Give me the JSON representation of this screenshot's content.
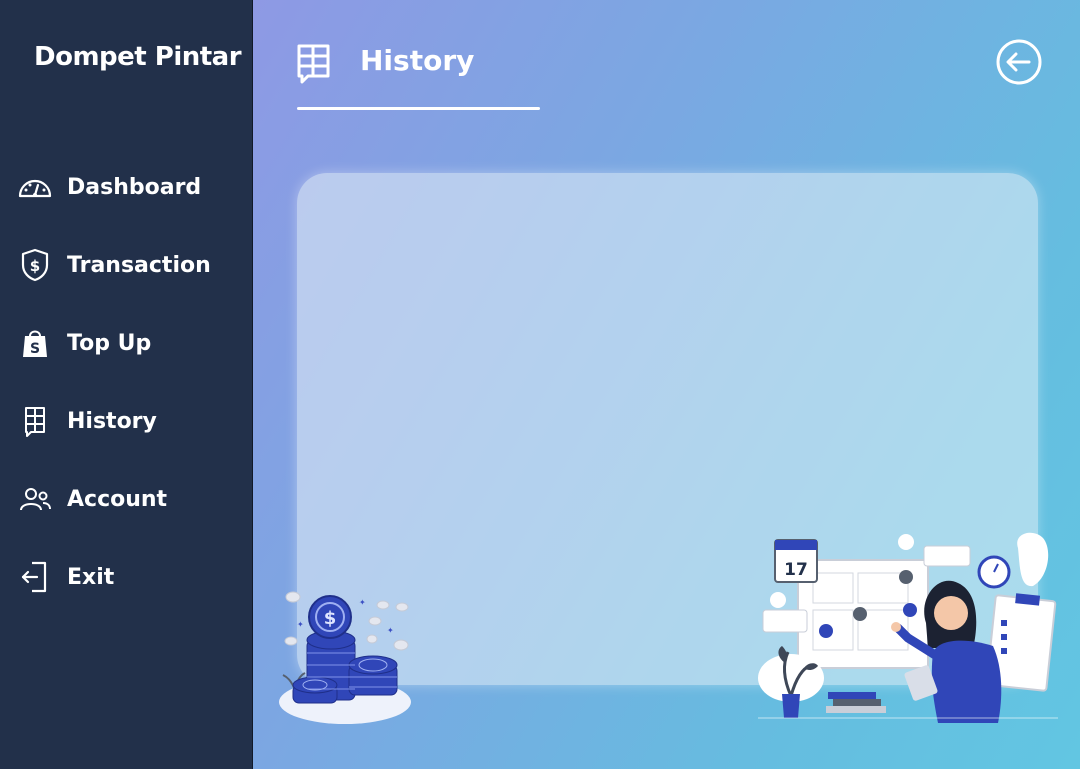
{
  "app": {
    "brand": "Dompet Pintar"
  },
  "sidebar": {
    "items": [
      {
        "label": "Dashboard",
        "icon": "dashboard-gauge-icon"
      },
      {
        "label": "Transaction",
        "icon": "shield-dollar-icon"
      },
      {
        "label": "Top Up",
        "icon": "shopping-bag-icon"
      },
      {
        "label": "History",
        "icon": "table-history-icon"
      },
      {
        "label": "Account",
        "icon": "users-icon"
      },
      {
        "label": "Exit",
        "icon": "exit-door-icon"
      }
    ]
  },
  "header": {
    "title": "History",
    "icon": "table-history-icon",
    "back_icon": "arrow-left-circle-icon"
  },
  "calendar_day": "17",
  "colors": {
    "sidebar": "#22304a",
    "gradient_start": "#8e99e4",
    "gradient_end": "#62c6e2",
    "accent_blue": "#2f47b8"
  }
}
